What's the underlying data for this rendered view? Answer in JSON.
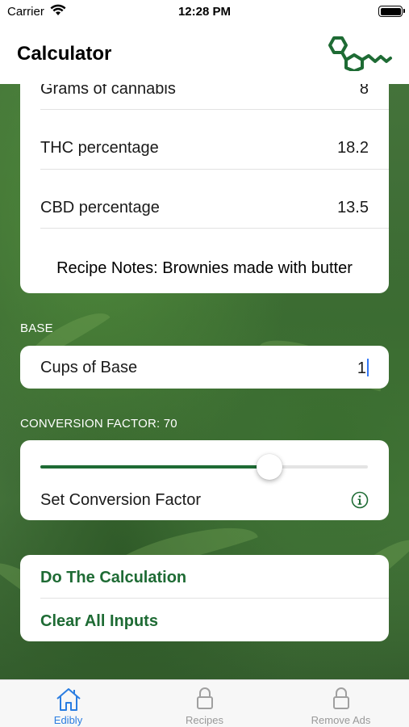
{
  "status_bar": {
    "carrier": "Carrier",
    "time": "12:28 PM"
  },
  "nav": {
    "title": "Calculator",
    "logo_icon": "molecule-logo-icon"
  },
  "inputs_card": {
    "rows": [
      {
        "label": "Grams of cannabis",
        "value": "8"
      },
      {
        "label": "THC percentage",
        "value": "18.2"
      },
      {
        "label": "CBD percentage",
        "value": "13.5"
      }
    ],
    "notes": "Recipe Notes: Brownies made with butter"
  },
  "base_section": {
    "header": "BASE",
    "label": "Cups of Base",
    "value": "1"
  },
  "conversion_section": {
    "header": "CONVERSION FACTOR: 70",
    "slider_fraction": 0.7,
    "label": "Set Conversion Factor",
    "info_icon": "info-icon"
  },
  "actions": {
    "calculate": "Do The Calculation",
    "clear": "Clear All Inputs"
  },
  "tabs": [
    {
      "label": "Edibly",
      "icon": "home-icon",
      "active": true
    },
    {
      "label": "Recipes",
      "icon": "lock-icon",
      "active": false
    },
    {
      "label": "Remove Ads",
      "icon": "lock-icon",
      "active": false
    }
  ],
  "colors": {
    "accent_green": "#1e6b34",
    "tab_active": "#2a7de1",
    "tab_inactive": "#999999"
  }
}
